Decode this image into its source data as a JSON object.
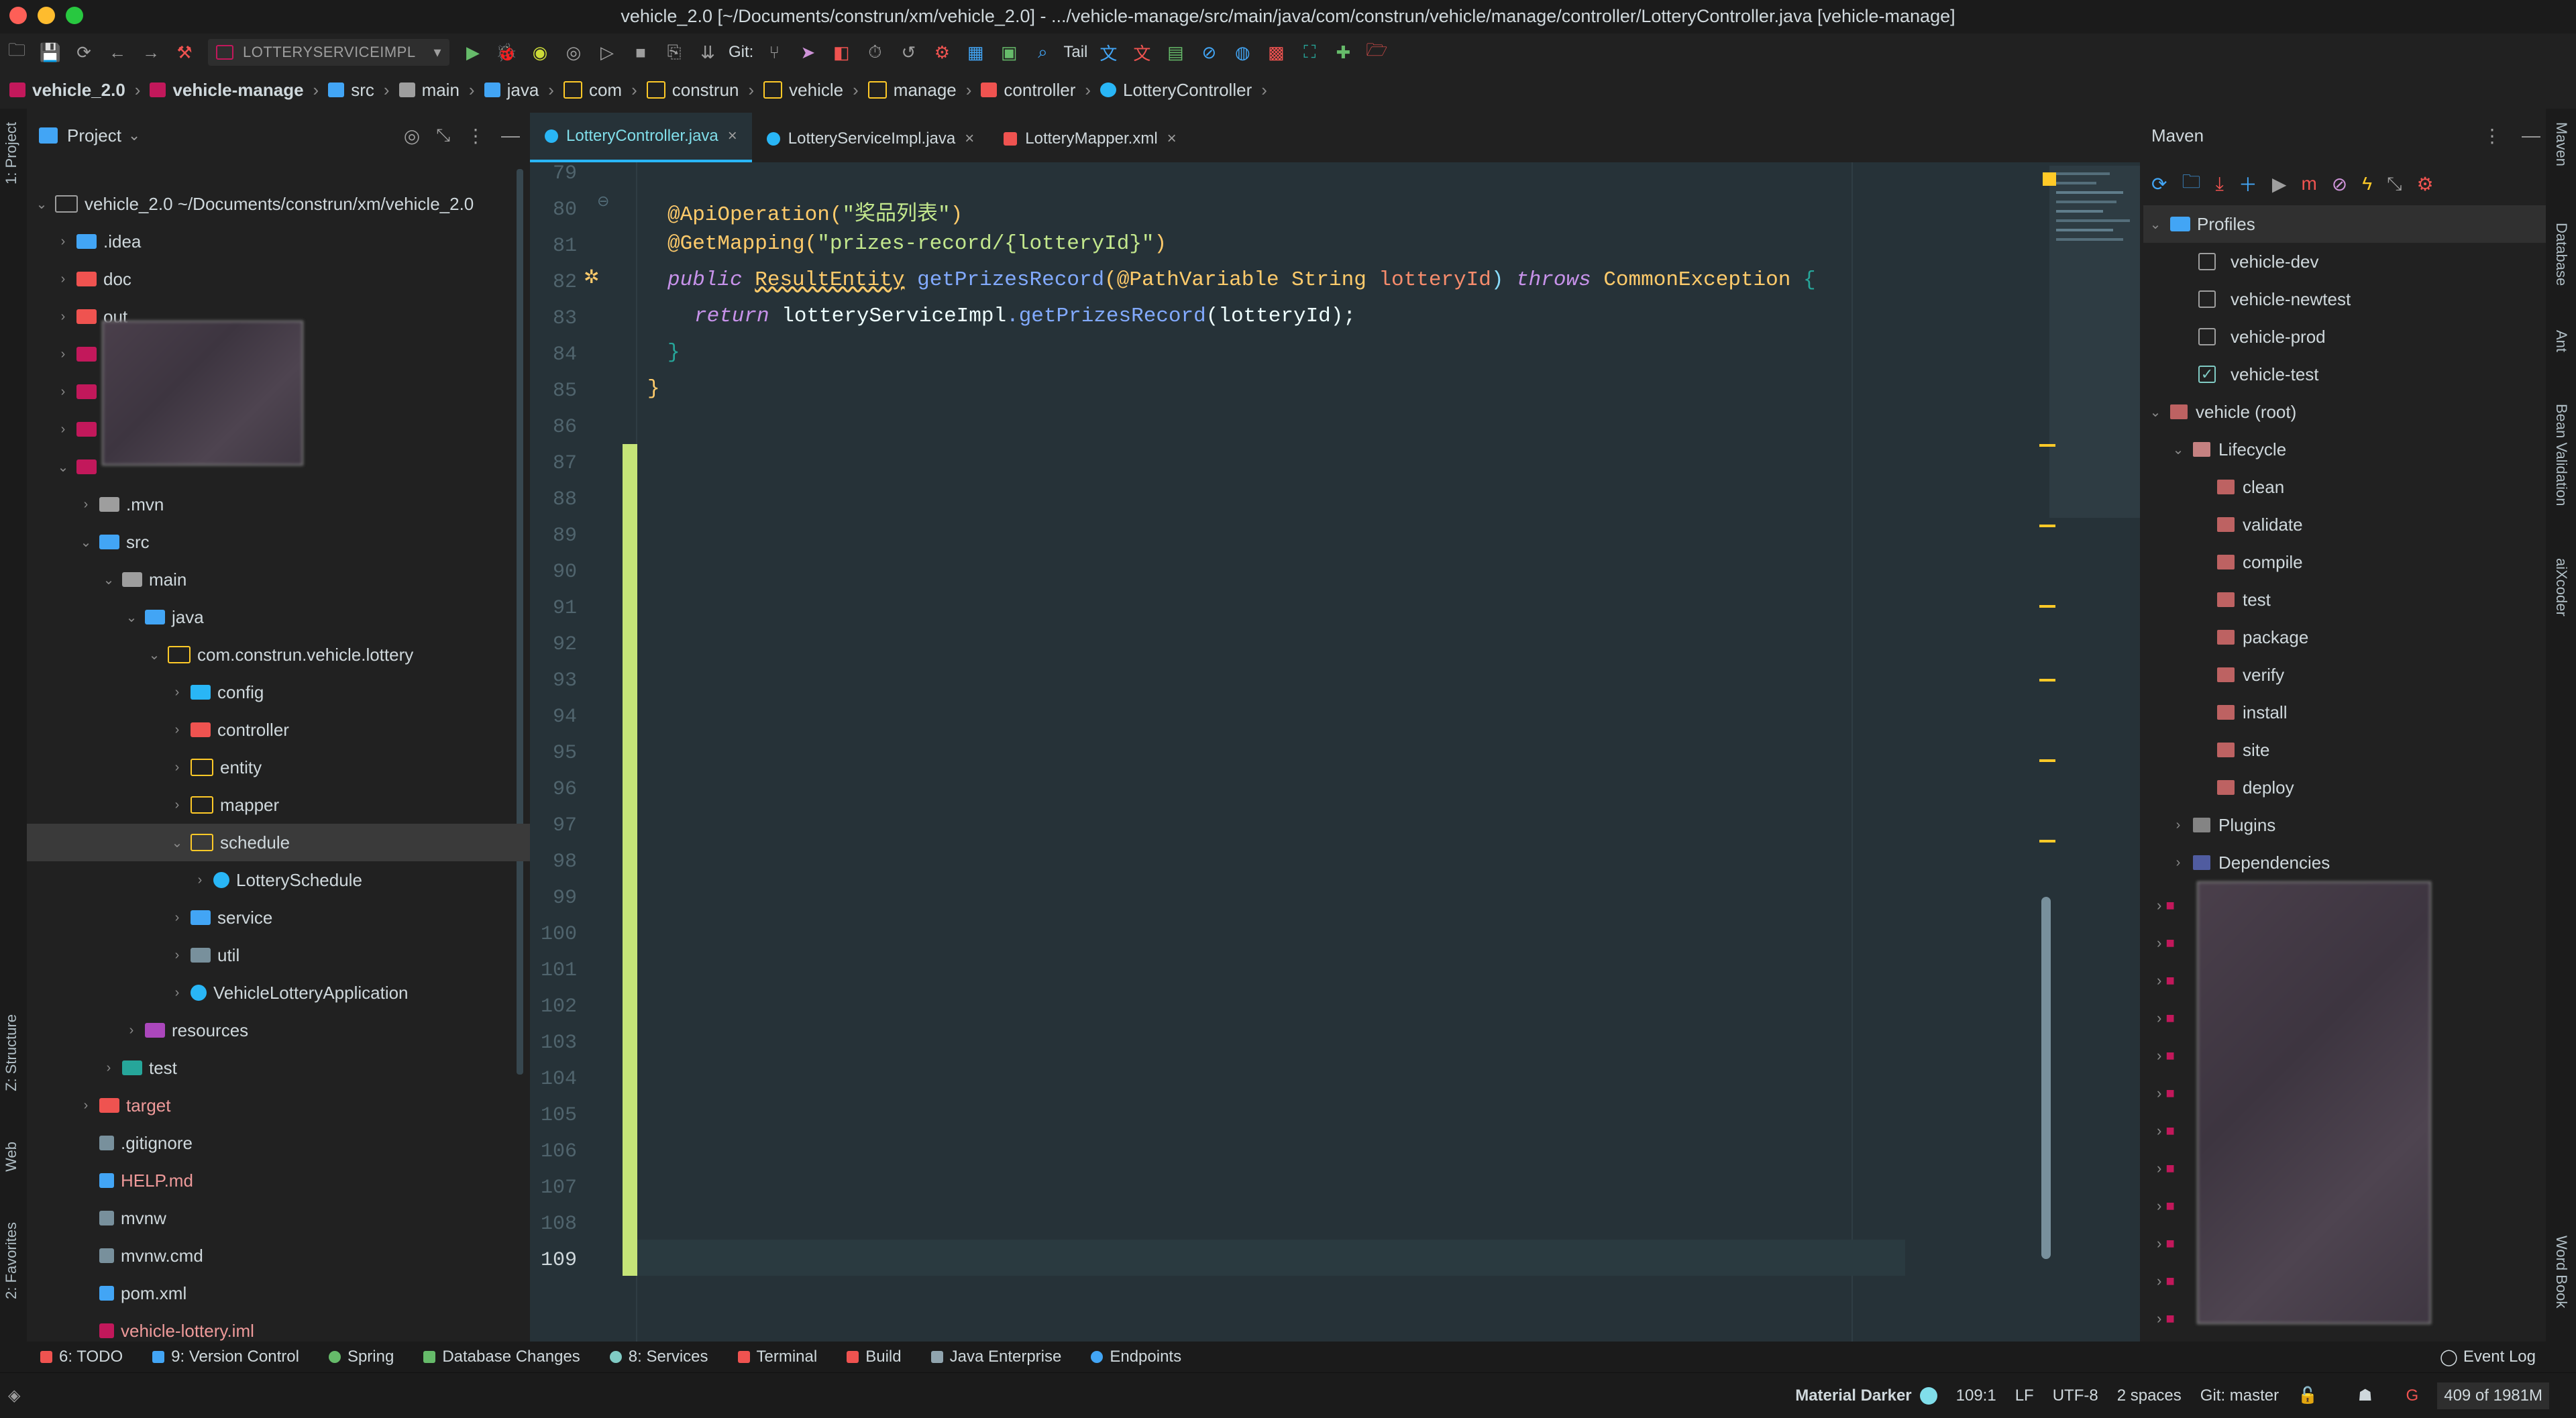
{
  "window": {
    "title": "vehicle_2.0 [~/Documents/construn/xm/vehicle_2.0] - .../vehicle-manage/src/main/java/com/construn/vehicle/manage/controller/LotteryController.java [vehicle-manage]"
  },
  "toolbar": {
    "run_config": "LOTTERYSERVICEIMPL",
    "git_label": "Git:",
    "tail_label": "Tail"
  },
  "breadcrumb": [
    "vehicle_2.0",
    "vehicle-manage",
    "src",
    "main",
    "java",
    "com",
    "construn",
    "vehicle",
    "manage",
    "controller",
    "LotteryController"
  ],
  "left_strip": {
    "project": "1: Project",
    "structure": "Z: Structure",
    "web": "Web",
    "favorites": "2: Favorites"
  },
  "project_panel": {
    "title": "Project",
    "root": "vehicle_2.0 ~/Documents/construn/xm/vehicle_2.0",
    "items": [
      ".idea",
      "doc",
      "out",
      ".mvn",
      "src",
      "main",
      "java",
      "com.construn.vehicle.lottery",
      "config",
      "controller",
      "entity",
      "mapper",
      "schedule",
      "LotterySchedule",
      "service",
      "util",
      "VehicleLotteryApplication",
      "resources",
      "test",
      "target",
      ".gitignore",
      "HELP.md",
      "mvnw",
      "mvnw.cmd",
      "pom.xml",
      "vehicle-lottery.iml"
    ]
  },
  "editor": {
    "tabs": [
      "LotteryController.java",
      "LotteryServiceImpl.java",
      "LotteryMapper.xml"
    ],
    "line_numbers": [
      "79",
      "80",
      "81",
      "82",
      "83",
      "84",
      "85",
      "86",
      "87",
      "88",
      "89",
      "90",
      "91",
      "92",
      "93",
      "94",
      "95",
      "96",
      "97",
      "98",
      "99",
      "100",
      "101",
      "102",
      "103",
      "104",
      "105",
      "106",
      "107",
      "108",
      "109"
    ],
    "code": {
      "l80_ann": "@ApiOperation(",
      "l80_str": "\"奖品列表\"",
      "l80_end": ")",
      "l81_ann": "@GetMapping(",
      "l81_str": "\"prizes-record/{lotteryId}\"",
      "l81_end": ")",
      "l82_kw": "public ",
      "l82_type": "ResultEntity",
      "l82_fn": " getPrizesRecord",
      "l82_p1": "(@PathVariable String ",
      "l82_param": "lotteryId",
      "l82_p2": ") ",
      "l82_throws": "throws ",
      "l82_exc": "CommonException ",
      "l82_brace": "{",
      "l83_kw": "return ",
      "l83_obj": "lotteryServiceImpl",
      "l83_fn": ".getPrizesRecord",
      "l83_rest": "(lotteryId);",
      "l84": "}",
      "l85": "}"
    }
  },
  "maven": {
    "title": "Maven",
    "profiles_label": "Profiles",
    "profiles": [
      {
        "name": "vehicle-dev",
        "checked": false
      },
      {
        "name": "vehicle-newtest",
        "checked": false
      },
      {
        "name": "vehicle-prod",
        "checked": false
      },
      {
        "name": "vehicle-test",
        "checked": true
      }
    ],
    "root": "vehicle (root)",
    "lifecycle_label": "Lifecycle",
    "lifecycle": [
      "clean",
      "validate",
      "compile",
      "test",
      "package",
      "verify",
      "install",
      "site",
      "deploy"
    ],
    "plugins": "Plugins",
    "dependencies": "Dependencies"
  },
  "right_strip": {
    "maven": "Maven",
    "database": "Database",
    "ant": "Ant",
    "bean": "Bean Validation",
    "aixcoder": "aiXcoder",
    "wordbook": "Word Book"
  },
  "tool_windows": [
    "6: TODO",
    "9: Version Control",
    "Spring",
    "Database Changes",
    "8: Services",
    "Terminal",
    "Build",
    "Java Enterprise",
    "Endpoints"
  ],
  "event_log": "Event Log",
  "status": {
    "theme": "Material Darker",
    "position": "109:1",
    "line_sep": "LF",
    "encoding": "UTF-8",
    "indent": "2 spaces",
    "git": "Git: master",
    "memory": "409 of 1981M"
  },
  "colors": {
    "accent": "#29b6f6",
    "editor_bg": "#263238",
    "panel_bg": "#212121",
    "added_bar": "#c5e478"
  }
}
